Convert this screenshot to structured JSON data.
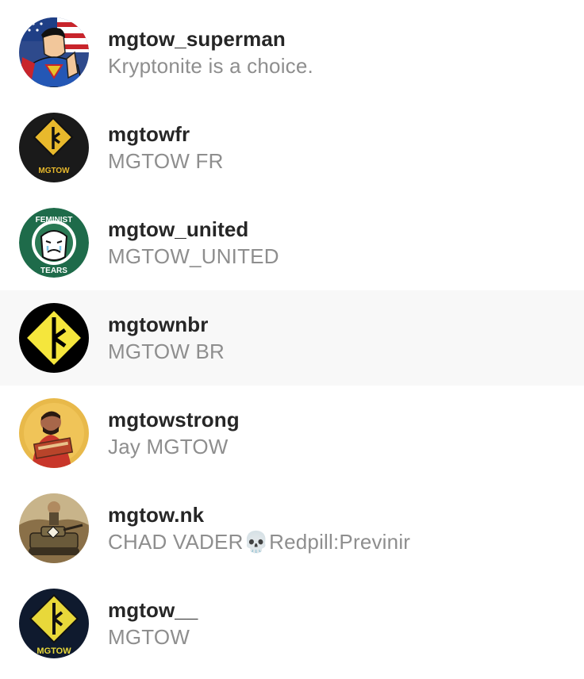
{
  "accounts": [
    {
      "username": "mgtow_superman",
      "full_name": "Kryptonite is a choice.",
      "avatar_icon": "superman-avatar-icon",
      "highlighted": false
    },
    {
      "username": "mgtowfr",
      "full_name": "MGTOW FR",
      "avatar_icon": "mgtow-sign-avatar-icon",
      "avatar_caption": "MGTOW",
      "highlighted": false
    },
    {
      "username": "mgtow_united",
      "full_name": "MGTOW_UNITED",
      "avatar_icon": "feminist-tears-avatar-icon",
      "avatar_caption_top": "FEMINIST",
      "avatar_caption_bottom": "TEARS",
      "highlighted": false
    },
    {
      "username": "mgtownbr",
      "full_name": "MGTOW BR",
      "avatar_icon": "mgtow-sign-avatar-icon",
      "highlighted": true
    },
    {
      "username": "mgtowstrong",
      "full_name": "Jay MGTOW",
      "avatar_icon": "person-avatar-icon",
      "highlighted": false
    },
    {
      "username": "mgtow.nk",
      "full_name": "CHAD VADER💀Redpill:Previnir",
      "avatar_icon": "tank-avatar-icon",
      "highlighted": false
    },
    {
      "username": "mgtow__",
      "full_name": "MGTOW",
      "avatar_icon": "mgtow-sign-avatar-icon",
      "avatar_caption": "MGTOW",
      "highlighted": false
    }
  ],
  "colors": {
    "username": "#262626",
    "full_name": "#8e8e8e",
    "highlight_row": "#f8f8f8",
    "sign_yellow": "#f5d742"
  }
}
